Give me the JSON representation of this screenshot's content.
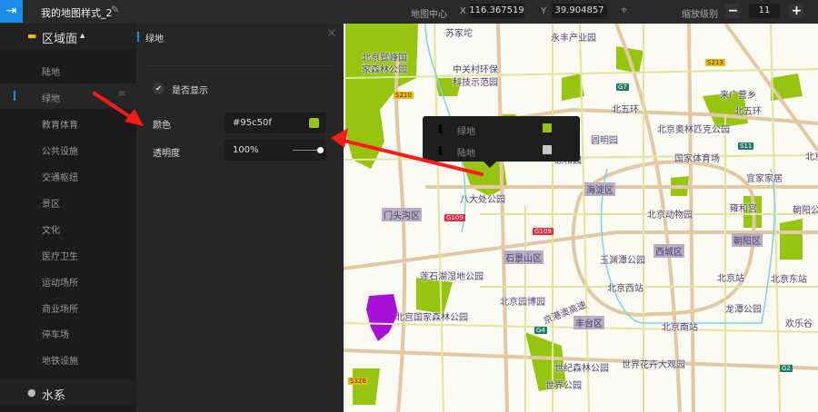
{
  "topbar": {
    "title": "我的地图样式_2",
    "map_center_label": "地图中心",
    "x_label": "X",
    "x_value": "116.367519",
    "y_label": "Y",
    "y_value": "39.904857",
    "zoom_label": "缩放级别",
    "zoom_value": "11",
    "minus": "−",
    "plus": "+"
  },
  "sidebar": {
    "section_title": "区域面",
    "items": [
      {
        "label": "陆地"
      },
      {
        "label": "绿地"
      },
      {
        "label": "教育体育"
      },
      {
        "label": "公共设施"
      },
      {
        "label": "交通枢纽"
      },
      {
        "label": "景区"
      },
      {
        "label": "文化"
      },
      {
        "label": "医疗卫生"
      },
      {
        "label": "运动场所"
      },
      {
        "label": "商业场所"
      },
      {
        "label": "停车场"
      },
      {
        "label": "地铁设施"
      }
    ],
    "selected": "绿地",
    "section2_title": "水系"
  },
  "panel": {
    "title": "绿地",
    "visible_label": "是否显示",
    "visible": true,
    "color_label": "颜色",
    "color_value": "#95c50f",
    "opacity_label": "透明度",
    "opacity_value": "100%",
    "opacity": 1.0
  },
  "tooltip": {
    "items": [
      {
        "label": "绿地",
        "color": "#95c50f"
      },
      {
        "label": "陆地",
        "color": "#c8c8c8"
      }
    ]
  },
  "colors": {
    "accent": "#1a8ce8",
    "green": "#95c50f",
    "arrow": "#ff1a1a"
  },
  "map": {
    "labels": [
      "苏家坨",
      "永丰产业园",
      "中关村环保",
      "科技示范园",
      "北京鹫峰国",
      "家森林公园",
      "来广营乡",
      "北五环",
      "北五环",
      "北京奥林匹克公园",
      "圆明园",
      "颐和园",
      "国家体育场",
      "宜家家居",
      "北京",
      "八大处公园",
      "北京动物园",
      "雍和宫",
      "朝阳公",
      "玉渊潭公园",
      "北京站",
      "北京东站",
      "莲石湖湿地公园",
      "北京西站",
      "北京园博园",
      "北宫国家森林公园",
      "龙潭公园",
      "欢乐谷",
      "京港澳高速",
      "北京南站",
      "世纪森林公园",
      "世界花卉大观园",
      "世界公园"
    ],
    "districts": [
      "海淀区",
      "门头沟区",
      "朝阳区",
      "石景山区",
      "西城区",
      "丰台区"
    ],
    "shields": [
      "S210",
      "S213",
      "G7",
      "S11",
      "G109",
      "G109",
      "G4",
      "G2",
      "S328"
    ]
  }
}
